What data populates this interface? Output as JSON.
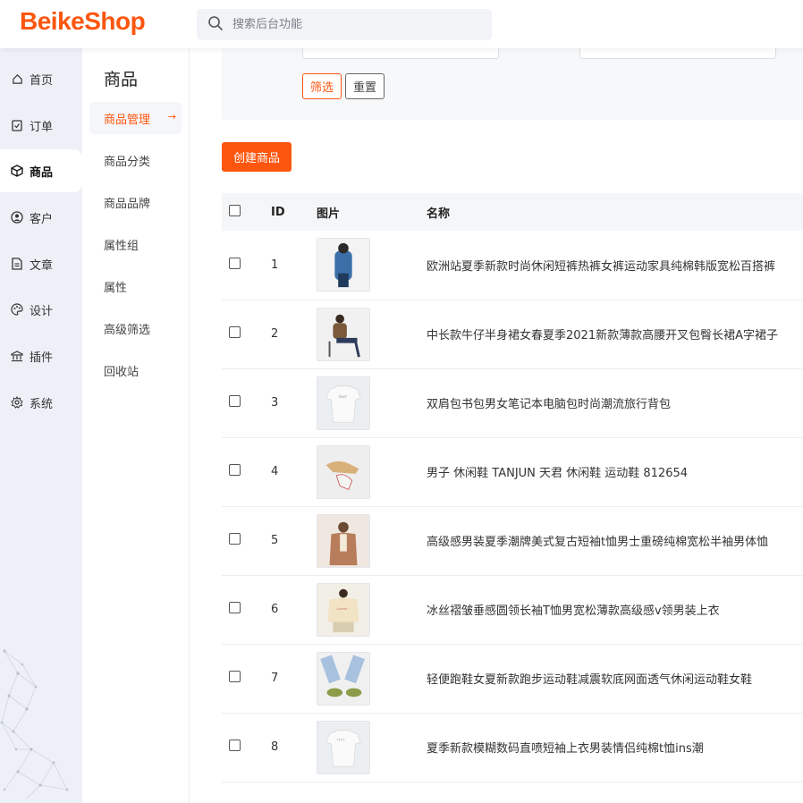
{
  "header": {
    "logo": "BeikeShop",
    "search_placeholder": "搜索后台功能"
  },
  "nav": [
    {
      "label": "首页",
      "icon": "home-icon"
    },
    {
      "label": "订单",
      "icon": "clipboard-icon"
    },
    {
      "label": "商品",
      "icon": "box-icon",
      "active": true
    },
    {
      "label": "客户",
      "icon": "user-circle-icon"
    },
    {
      "label": "文章",
      "icon": "document-icon"
    },
    {
      "label": "设计",
      "icon": "palette-icon"
    },
    {
      "label": "插件",
      "icon": "plugin-icon"
    },
    {
      "label": "系统",
      "icon": "gear-icon"
    }
  ],
  "submenu": {
    "title": "商品",
    "items": [
      "商品管理",
      "商品分类",
      "商品品牌",
      "属性组",
      "属性",
      "高级筛选",
      "回收站"
    ]
  },
  "filter": {
    "filter_label": "筛选",
    "reset_label": "重置"
  },
  "create_button": "创建商品",
  "table": {
    "headers": {
      "id": "ID",
      "image": "图片",
      "name": "名称"
    },
    "rows": [
      {
        "id": "1",
        "name": "欧洲站夏季新款时尚休闲短裤热裤女裤运动家具纯棉韩版宽松百搭裤"
      },
      {
        "id": "2",
        "name": "中长款牛仔半身裙女春夏季2021新款薄款高腰开叉包臀长裙A字裙子"
      },
      {
        "id": "3",
        "name": "双肩包书包男女笔记本电脑包时尚潮流旅行背包"
      },
      {
        "id": "4",
        "name": "男子 休闲鞋 TANJUN 天君 休闲鞋 运动鞋 812654"
      },
      {
        "id": "5",
        "name": "高级感男装夏季潮牌美式复古短袖t恤男士重磅纯棉宽松半袖男体恤"
      },
      {
        "id": "6",
        "name": "冰丝褶皱垂感圆领长袖T恤男宽松薄款高级感v领男装上衣"
      },
      {
        "id": "7",
        "name": "轻便跑鞋女夏新款跑步运动鞋减震软底网面透气休闲运动鞋女鞋"
      },
      {
        "id": "8",
        "name": "夏季新款模糊数码直喷短袖上衣男装情侣纯棉t恤ins潮"
      }
    ]
  },
  "colors": {
    "accent": "#fd560f",
    "sidebar_bg": "#edf0f7"
  }
}
